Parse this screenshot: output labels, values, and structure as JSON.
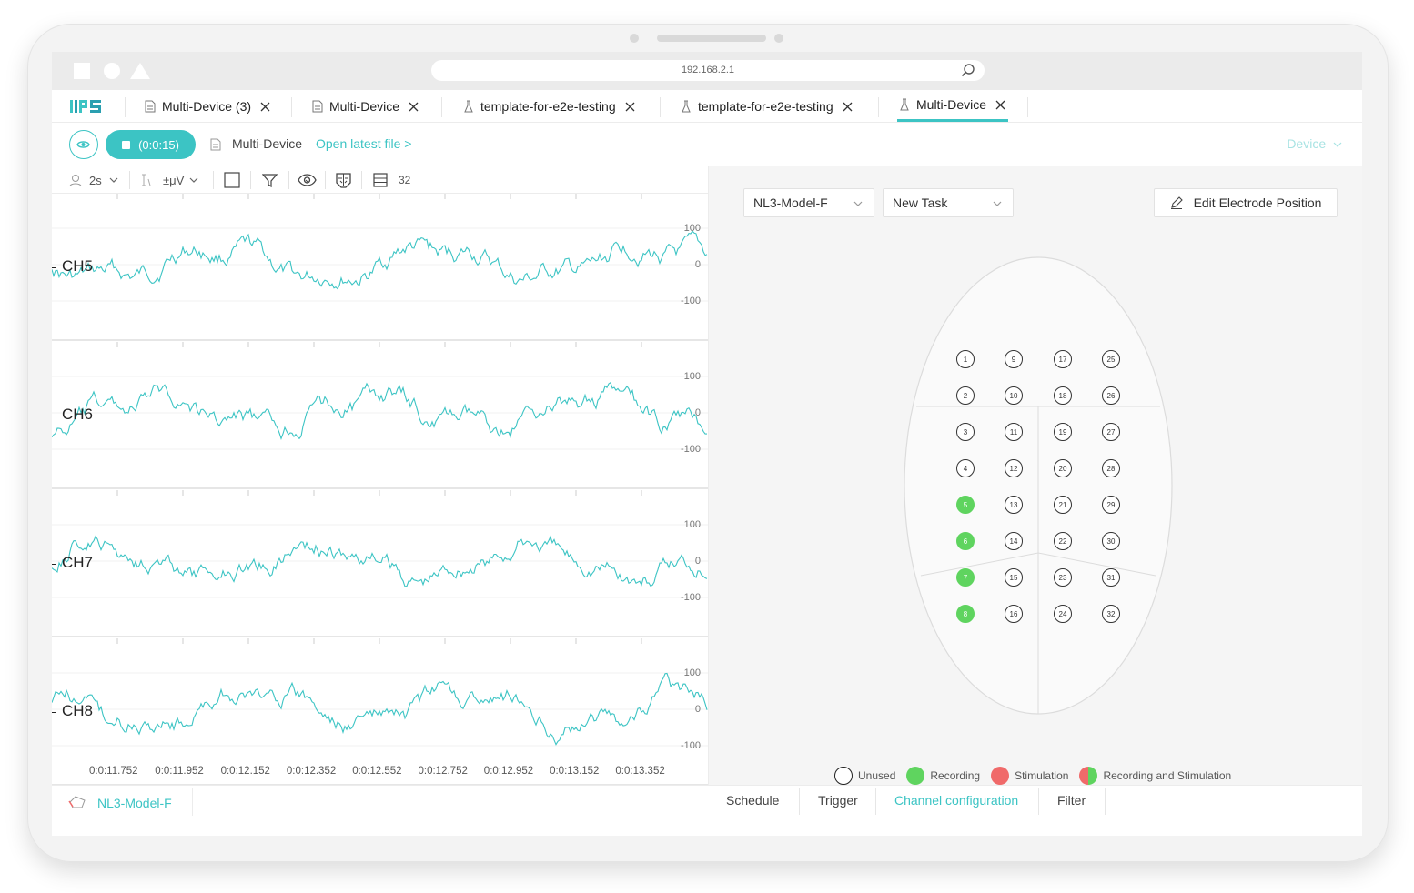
{
  "browser": {
    "url": "192.168.2.1"
  },
  "app": {
    "logo_text": "IIPS"
  },
  "tabs": [
    {
      "label": "Multi-Device (3)",
      "icon": "document-icon"
    },
    {
      "label": "Multi-Device",
      "icon": "document-icon"
    },
    {
      "label": "template-for-e2e-testing",
      "icon": "flask-icon"
    },
    {
      "label": "template-for-e2e-testing",
      "icon": "flask-icon"
    },
    {
      "label": "Multi-Device",
      "icon": "flask-icon",
      "active": true
    }
  ],
  "toolbar": {
    "record_label": "(0:0:15)",
    "file_name": "Multi-Device",
    "open_latest": "Open latest file >",
    "device_label": "Device"
  },
  "signal_toolbar": {
    "timescale": "2s",
    "amplitude": "±μV",
    "channel_count": "32"
  },
  "channels": [
    {
      "name": "CH5",
      "ticks": [
        "100",
        "0",
        "-100"
      ]
    },
    {
      "name": "CH6",
      "ticks": [
        "100",
        "0",
        "-100"
      ]
    },
    {
      "name": "CH7",
      "ticks": [
        "100",
        "0",
        "-100"
      ]
    },
    {
      "name": "CH8",
      "ticks": [
        "100",
        "0",
        "-100"
      ]
    }
  ],
  "time_labels": [
    "0:0:11.752",
    "0:0:11.952",
    "0:0:12.152",
    "0:0:12.352",
    "0:0:12.552",
    "0:0:12.752",
    "0:0:12.952",
    "0:0:13.152",
    "0:0:13.352"
  ],
  "left_footer": {
    "model_name": "NL3-Model-F"
  },
  "right_panel": {
    "model_select": "NL3-Model-F",
    "task_select": "New Task",
    "edit_button": "Edit Electrode Position"
  },
  "electrodes": {
    "recording": [
      5,
      6,
      7,
      8
    ]
  },
  "legend": [
    {
      "label": "Unused",
      "color": "#ffffff"
    },
    {
      "label": "Recording",
      "color": "#5fd45f"
    },
    {
      "label": "Stimulation",
      "color": "#f06a6a"
    },
    {
      "label": "Recording and Stimulation",
      "color": "split"
    }
  ],
  "bottom_tabs": [
    {
      "label": "Schedule"
    },
    {
      "label": "Trigger"
    },
    {
      "label": "Channel configuration",
      "active": true
    },
    {
      "label": "Filter"
    }
  ],
  "colors": {
    "accent": "#3cc4c4",
    "signal": "#3cc4c4",
    "recording": "#5fd45f",
    "stimulation": "#f06a6a"
  }
}
